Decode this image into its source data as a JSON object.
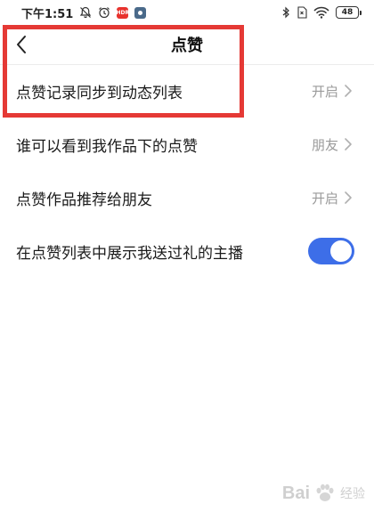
{
  "status_bar": {
    "time": "下午1:51",
    "red_app_badge": "HDR",
    "battery": "48"
  },
  "nav": {
    "title": "点赞"
  },
  "settings": [
    {
      "label": "点赞记录同步到动态列表",
      "value": "开启",
      "type": "link"
    },
    {
      "label": "谁可以看到我作品下的点赞",
      "value": "朋友",
      "type": "link"
    },
    {
      "label": "点赞作品推荐给朋友",
      "value": "开启",
      "type": "link"
    },
    {
      "label": "在点赞列表中展示我送过礼的主播",
      "type": "toggle",
      "on": true
    }
  ],
  "watermark": {
    "brand": "Bai",
    "brand_suffix": "经验"
  },
  "colors": {
    "toggle_on": "#3d6ee8",
    "highlight": "#e53935",
    "secondary_text": "#9a9a9a"
  }
}
